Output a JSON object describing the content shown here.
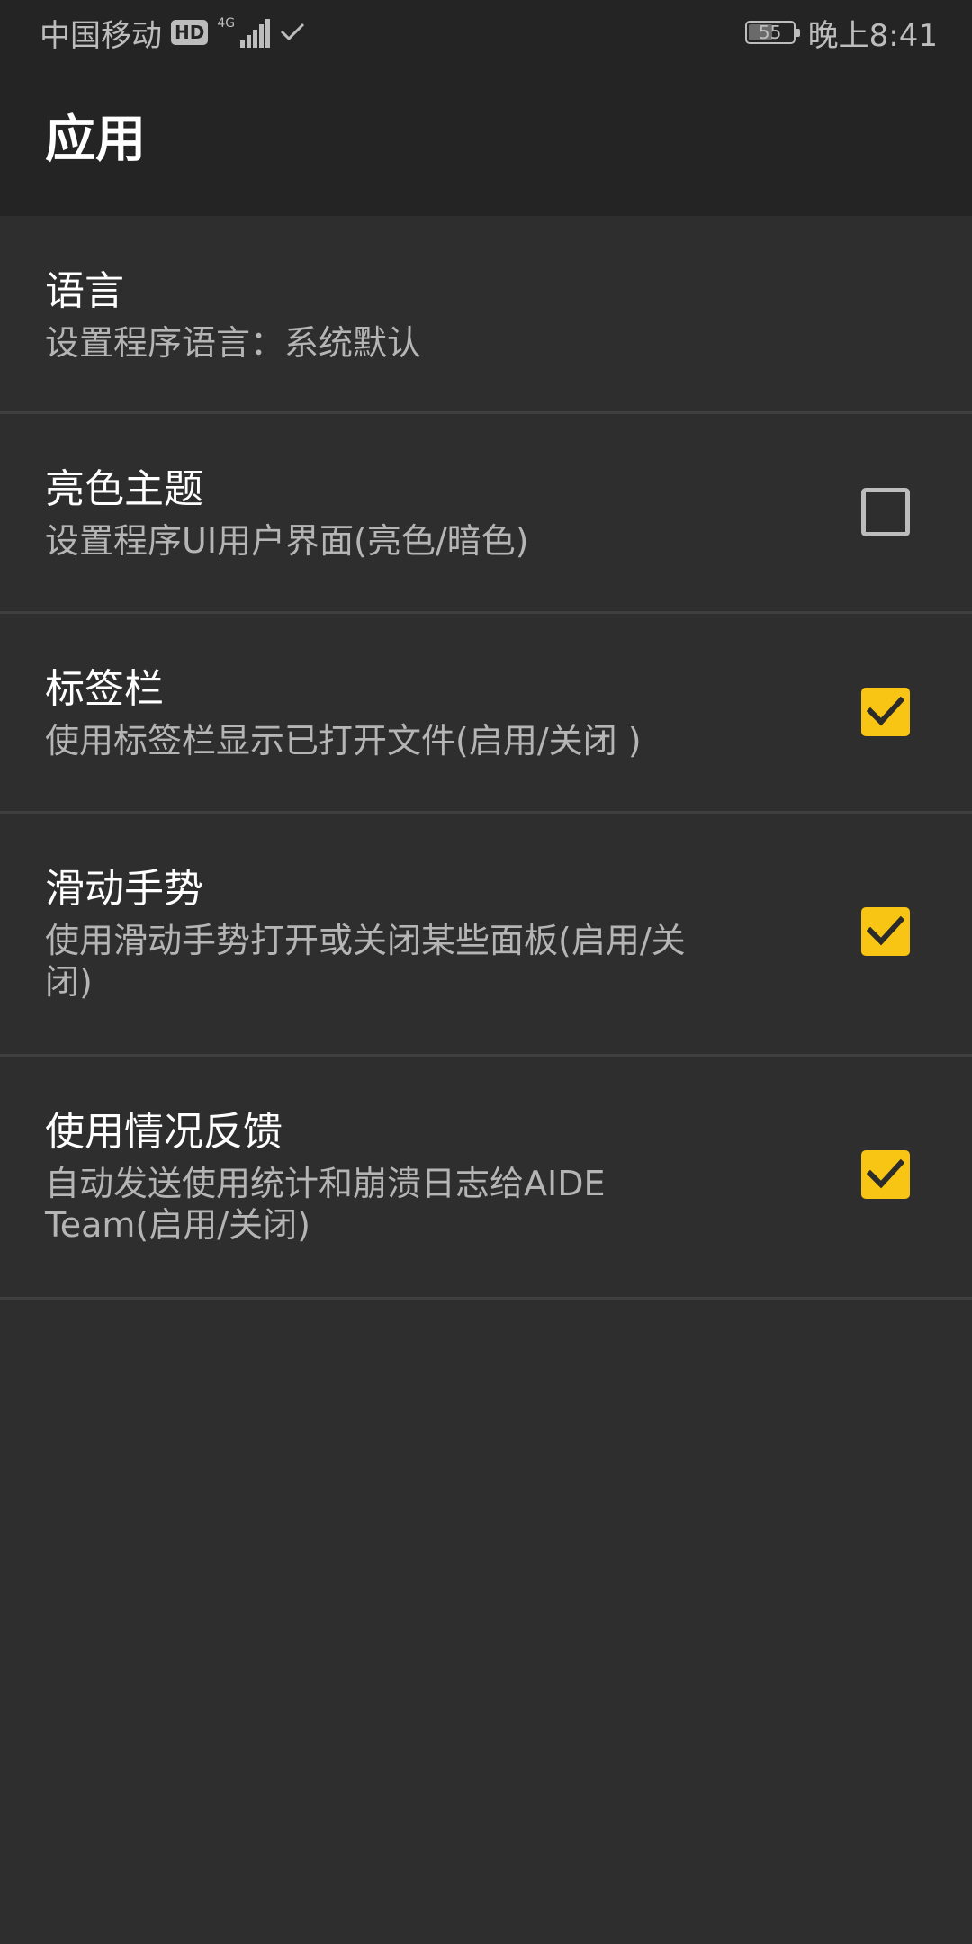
{
  "status_bar": {
    "carrier": "中国移动",
    "hd_badge": "HD",
    "network": "4G",
    "battery": "55",
    "battery_level_percent": 55,
    "time": "晚上8:41"
  },
  "action_bar": {
    "title": "应用"
  },
  "settings": [
    {
      "title": "语言",
      "summary": "设置程序语言：系统默认",
      "has_checkbox": false
    },
    {
      "title": "亮色主题",
      "summary": "设置程序UI用户界面(亮色/暗色)",
      "has_checkbox": true,
      "checked": false
    },
    {
      "title": "标签栏",
      "summary": "使用标签栏显示已打开文件(启用/关闭 )",
      "has_checkbox": true,
      "checked": true
    },
    {
      "title": "滑动手势",
      "summary_line1": "使用滑动手势打开或关闭某些面板(启用/关",
      "summary_line2": "闭)",
      "has_checkbox": true,
      "checked": true
    },
    {
      "title": "使用情况反馈",
      "summary_line1": "自动发送使用统计和崩溃日志给AIDE",
      "summary_line2": "Team(启用/关闭)",
      "has_checkbox": true,
      "checked": true
    }
  ],
  "colors": {
    "background": "#2e2e2e",
    "toolbar": "#242424",
    "divider": "#3f3f3f",
    "accent": "#f9c514",
    "summary_text": "#b5b5b5"
  }
}
